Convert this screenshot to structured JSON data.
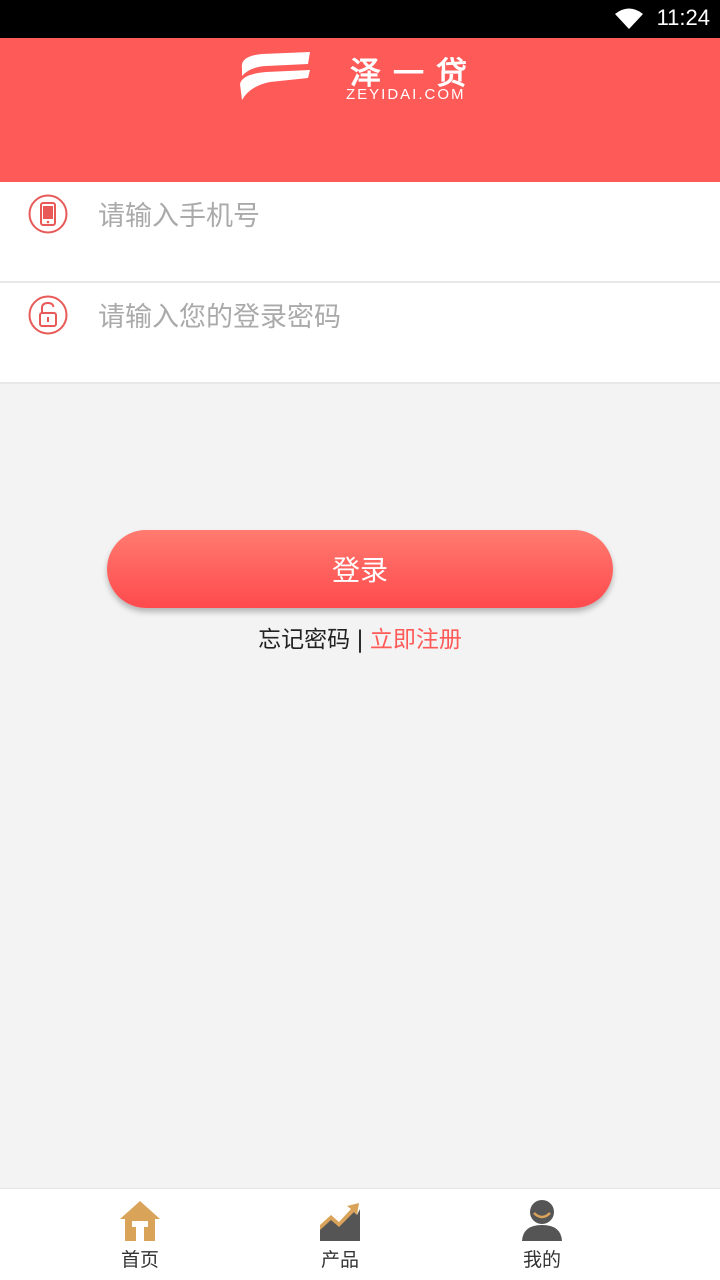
{
  "status_bar": {
    "time": "11:24"
  },
  "header": {
    "brand_name": "泽一贷",
    "brand_sub": "ZEYIDAI.COM",
    "logo_icon": "zeyidai-logo-icon"
  },
  "form": {
    "phone": {
      "placeholder": "请输入手机号",
      "value": "",
      "icon": "phone-icon"
    },
    "password": {
      "placeholder": "请输入您的登录密码",
      "value": "",
      "icon": "lock-icon"
    }
  },
  "login_button": {
    "label": "登录"
  },
  "links": {
    "forgot": "忘记密码",
    "separator": "|",
    "register": "立即注册"
  },
  "tabbar": {
    "items": [
      {
        "label": "首页",
        "icon": "home-icon"
      },
      {
        "label": "产品",
        "icon": "chart-icon"
      },
      {
        "label": "我的",
        "icon": "user-icon"
      }
    ]
  },
  "colors": {
    "accent": "#fe5a58",
    "background": "#f3f3f3",
    "tab_home": "#d9a35a",
    "tab_inactive": "#555555"
  }
}
